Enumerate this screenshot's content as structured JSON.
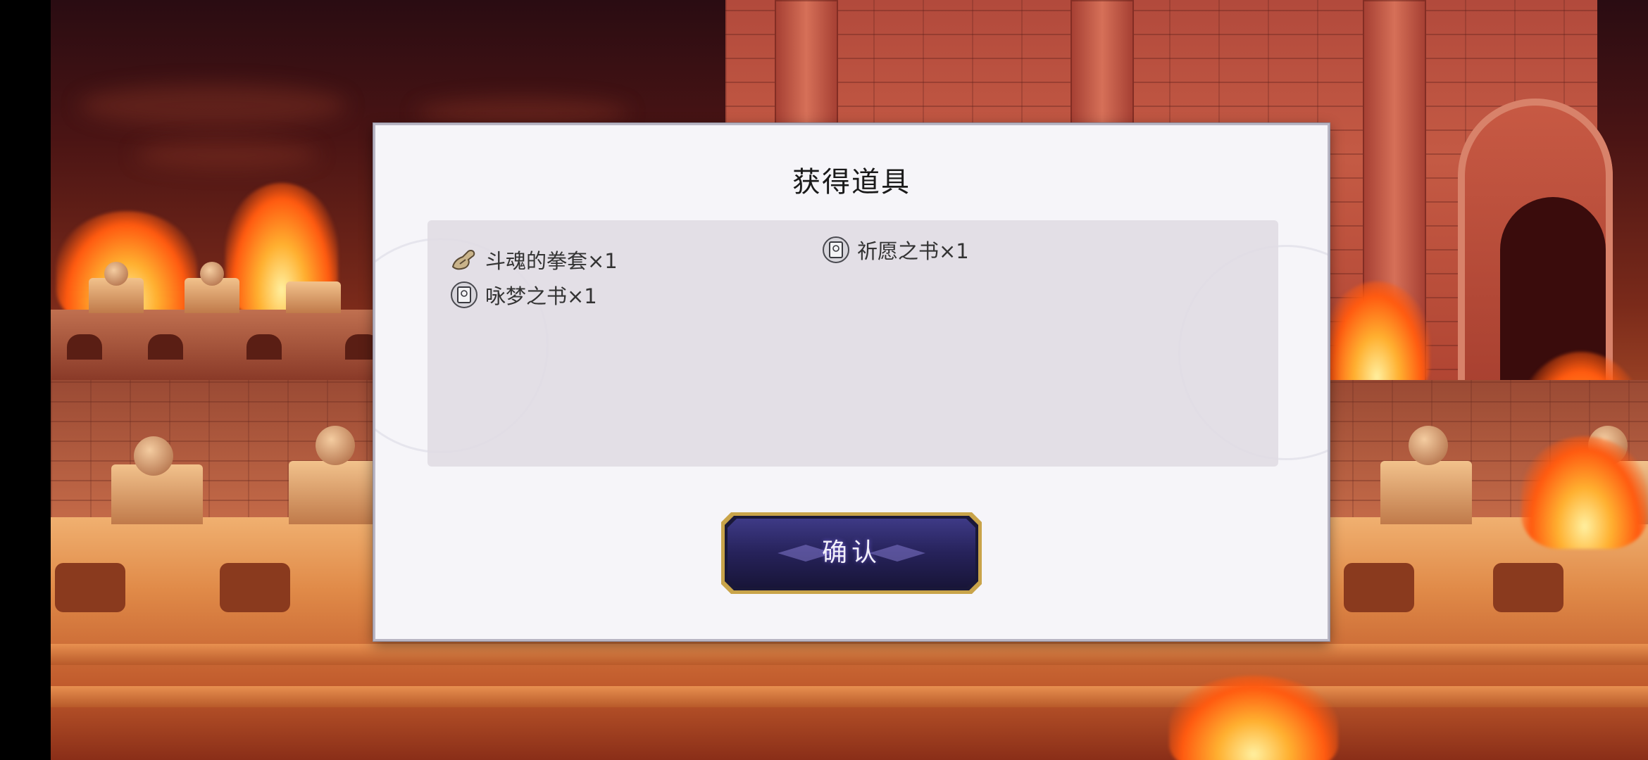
{
  "dialog": {
    "title": "获得道具",
    "confirm_label": "确认"
  },
  "items": [
    {
      "name": "斗魂的拳套×1",
      "icon": "gauntlet-icon"
    },
    {
      "name": "祈愿之书×1",
      "icon": "book-icon"
    },
    {
      "name": "咏梦之书×1",
      "icon": "book-icon"
    }
  ],
  "colors": {
    "dialog_bg": "#f6f5f9",
    "panel_bg": "#e1dce4",
    "button_bg": "#2a2560",
    "button_border": "#c9a44a"
  }
}
